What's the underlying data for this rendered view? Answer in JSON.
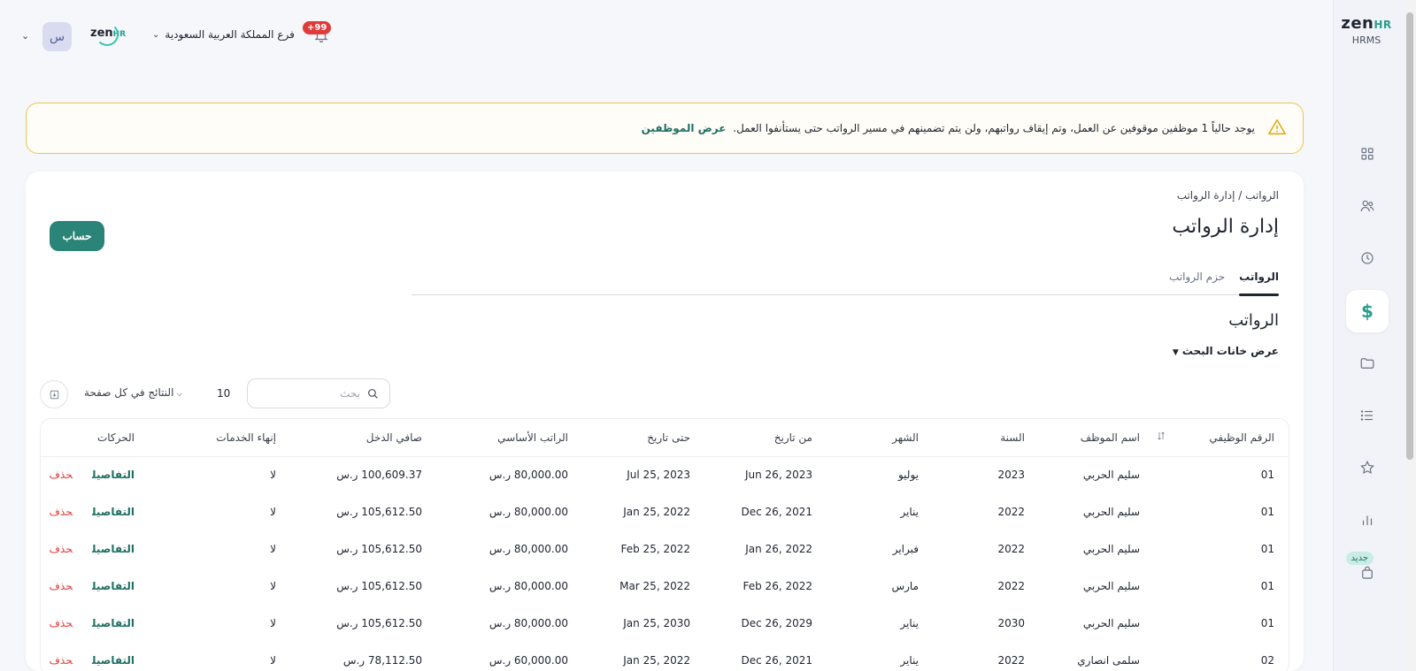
{
  "sidebar": {
    "brand": "zen",
    "brand_suffix": "HR",
    "brand_sub": "HRMS",
    "new_badge": "جديد",
    "active_item": "dollar-icon",
    "items": [
      "dashboard-icon",
      "people-icon",
      "clock-icon",
      "dollar-icon",
      "folder-icon",
      "list-icon",
      "star-icon",
      "chart-icon",
      "bag-icon"
    ]
  },
  "topbar": {
    "avatar_letter": "س",
    "logo": "zen",
    "logo_suffix": "HR",
    "branch": "فرع المملكة العربية السعودية",
    "notification_count": "+99"
  },
  "alert": {
    "message": "يوجد حالياً 1 موظفين موقوفين عن العمل، وتم إيقاف رواتبهم، ولن يتم تضمينهم في مسير الرواتب حتى يستأنفوا العمل.",
    "link": "عرض الموظفين"
  },
  "page": {
    "breadcrumb": "الرواتب / إدارة الرواتب",
    "title": "إدارة الرواتب",
    "calc_button": "حساب",
    "tabs": [
      "الرواتب",
      "حزم الرواتب"
    ],
    "section_title": "الرواتب",
    "toggle_search": "عرض خانات البحث",
    "search_placeholder": "بحث",
    "per_page_value": "10",
    "per_page_label": "النتائج في كل صفحة"
  },
  "table": {
    "headers": {
      "id": "الرقم الوظيفي",
      "name": "اسم الموظف",
      "year": "السنة",
      "month": "الشهر",
      "from": "من تاريخ",
      "to": "حتى تاريخ",
      "base": "الراتب الأساسي",
      "net": "صافي الدخل",
      "end": "إنهاء الخدمات",
      "actions": "الحركات"
    },
    "details_label": "التفاصيل",
    "delete_label": "حذف",
    "rows": [
      {
        "id": "01",
        "name": "سليم الحربي",
        "year": "2023",
        "month": "يوليو",
        "from": "Jun 26, 2023",
        "to": "Jul 25, 2023",
        "base": "80,000.00 ر.س",
        "net": "100,609.37 ر.س",
        "end": "لا"
      },
      {
        "id": "01",
        "name": "سليم الحربي",
        "year": "2022",
        "month": "يناير",
        "from": "Dec 26, 2021",
        "to": "Jan 25, 2022",
        "base": "80,000.00 ر.س",
        "net": "105,612.50 ر.س",
        "end": "لا"
      },
      {
        "id": "01",
        "name": "سليم الحربي",
        "year": "2022",
        "month": "فبراير",
        "from": "Jan 26, 2022",
        "to": "Feb 25, 2022",
        "base": "80,000.00 ر.س",
        "net": "105,612.50 ر.س",
        "end": "لا"
      },
      {
        "id": "01",
        "name": "سليم الحربي",
        "year": "2022",
        "month": "مارس",
        "from": "Feb 26, 2022",
        "to": "Mar 25, 2022",
        "base": "80,000.00 ر.س",
        "net": "105,612.50 ر.س",
        "end": "لا"
      },
      {
        "id": "01",
        "name": "سليم الحربي",
        "year": "2030",
        "month": "يناير",
        "from": "Dec 26, 2029",
        "to": "Jan 25, 2030",
        "base": "80,000.00 ر.س",
        "net": "105,612.50 ر.س",
        "end": "لا"
      },
      {
        "id": "02",
        "name": "سلمى انصاري",
        "year": "2022",
        "month": "يناير",
        "from": "Dec 26, 2021",
        "to": "Jan 25, 2022",
        "base": "60,000.00 ر.س",
        "net": "78,112.50 ر.س",
        "end": "لا"
      }
    ]
  }
}
